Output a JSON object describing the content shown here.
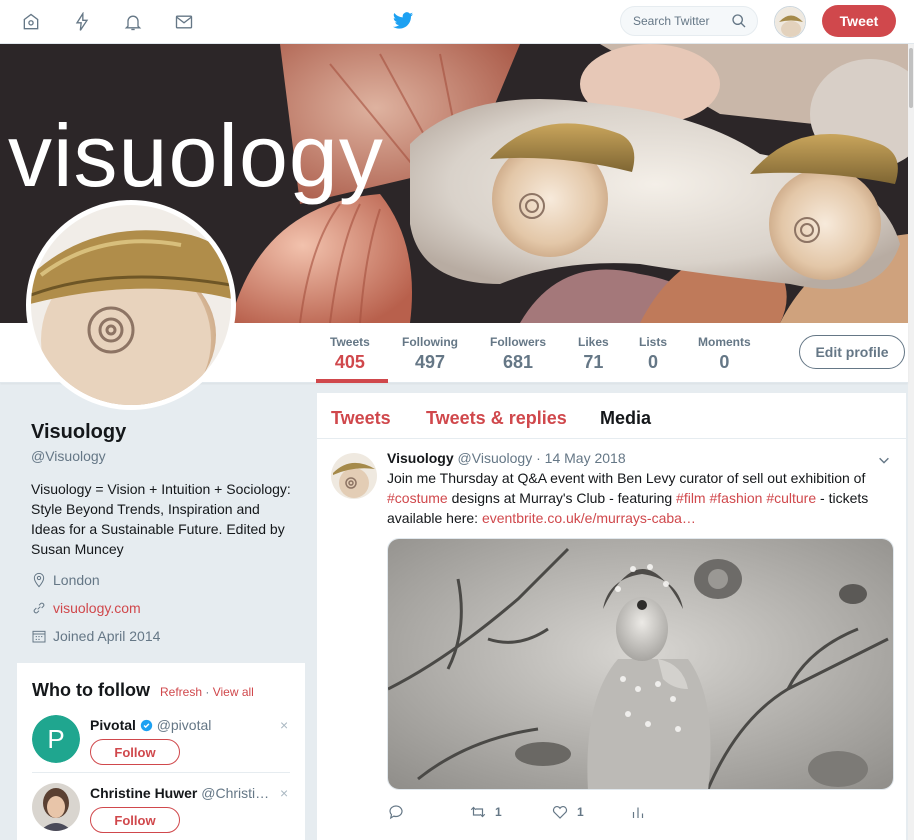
{
  "nav": {
    "home_icon": "home-icon",
    "moments_icon": "lightning-icon",
    "notifications_icon": "bell-icon",
    "messages_icon": "envelope-icon",
    "logo_icon": "twitter-bird-icon",
    "search_placeholder": "Search Twitter",
    "tweet_button": "Tweet"
  },
  "banner": {
    "title": "visuology"
  },
  "stats": [
    {
      "label": "Tweets",
      "value": "405"
    },
    {
      "label": "Following",
      "value": "497"
    },
    {
      "label": "Followers",
      "value": "681"
    },
    {
      "label": "Likes",
      "value": "71"
    },
    {
      "label": "Lists",
      "value": "0"
    },
    {
      "label": "Moments",
      "value": "0"
    }
  ],
  "edit_profile_label": "Edit profile",
  "profile": {
    "name": "Visuology",
    "handle": "@Visuology",
    "bio": "Visuology = Vision + Intuition + Sociology: Style Beyond Trends, Inspiration and Ideas for a Sustainable Future. Edited by Susan Muncey",
    "location": "London",
    "website": "visuology.com",
    "joined": "Joined April 2014"
  },
  "who_to_follow": {
    "title": "Who to follow",
    "refresh": "Refresh",
    "separator": " · ",
    "view_all": "View all",
    "users": [
      {
        "name": "Pivotal",
        "handle": "@pivotal",
        "follow": "Follow",
        "close": "×"
      },
      {
        "name": "Christine Huwer",
        "handle": "@Christi…",
        "follow": "Follow",
        "close": "×"
      }
    ]
  },
  "tabs": [
    "Tweets",
    "Tweets & replies",
    "Media"
  ],
  "tweet": {
    "name": "Visuology",
    "handle": "@Visuology",
    "dot": " · ",
    "date": "14 May 2018",
    "text_1": "Join me Thursday at Q&A event with Ben Levy curator of sell out exhibition of ",
    "tag_costume": "#costume",
    "text_2": " designs at Murray's Club - featuring ",
    "tag_film": "#film",
    "tag_fashion": "#fashion",
    "tag_culture": "#culture",
    "text_3": " - tickets available here: ",
    "link": "eventbrite.co.uk/e/murrays-caba…",
    "retweets": "1",
    "likes": "1"
  },
  "colors": {
    "accent": "#d0484c",
    "muted": "#657786",
    "background": "#e6ecf0"
  }
}
